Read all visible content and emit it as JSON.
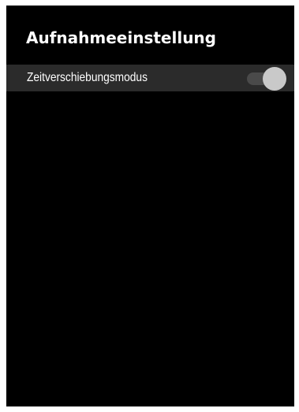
{
  "header": {
    "title": "Aufnahmeeinstellung"
  },
  "settings": [
    {
      "label": "Zeitverschiebungsmodus",
      "toggle_state": "off"
    }
  ],
  "colors": {
    "background": "#000000",
    "row_background": "#2b2b2b",
    "text": "#ffffff",
    "toggle_track": "#4a4a4a",
    "toggle_knob": "#c9c9c9"
  }
}
